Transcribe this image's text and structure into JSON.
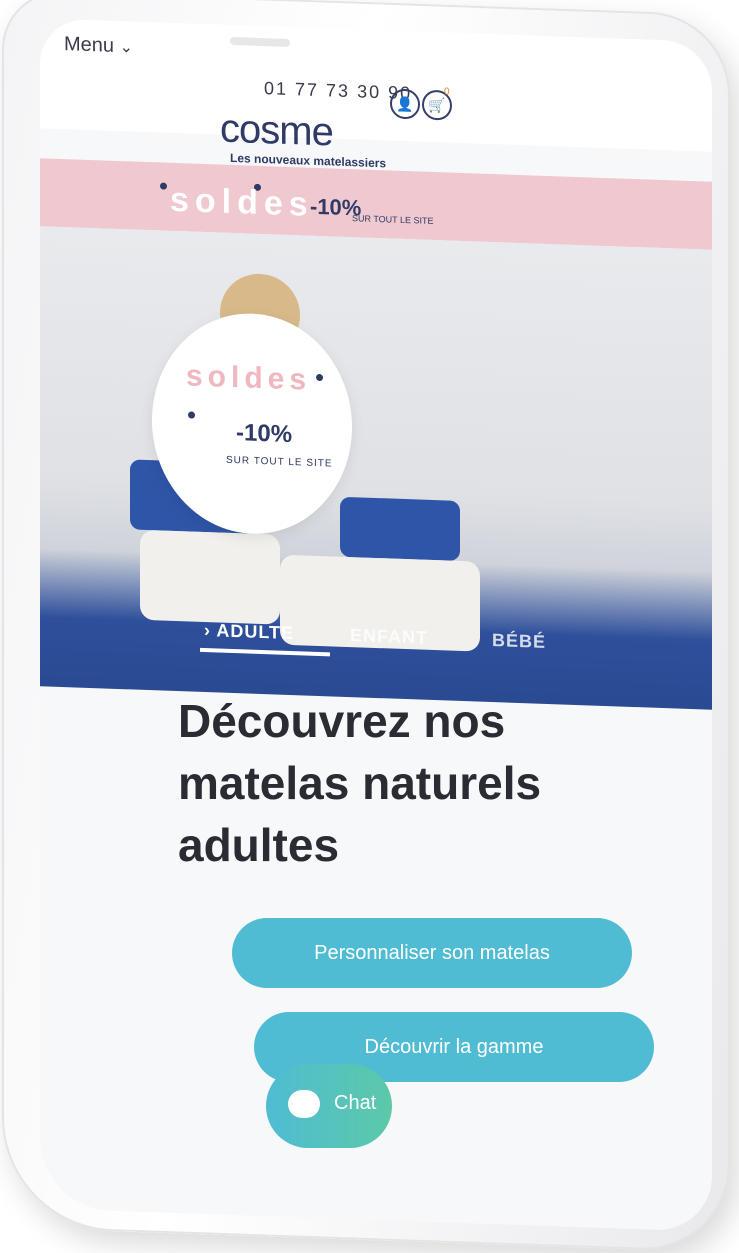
{
  "header": {
    "menu_label": "Menu",
    "phone": "01 77 73 30 90",
    "cart_count": "0",
    "logo": "cosme",
    "tagline": "Les nouveaux matelassiers"
  },
  "banner": {
    "soldes": "soldes",
    "discount": "-10%",
    "subtitle": "SUR TOUT LE SITE"
  },
  "hero": {
    "soldes": "soldes",
    "discount": "-10%",
    "subtitle": "SUR TOUT LE SITE",
    "tabs": [
      {
        "label": "ADULTE",
        "active": true
      },
      {
        "label": "ENFANT",
        "active": false
      },
      {
        "label": "BÉBÉ",
        "active": false
      }
    ]
  },
  "main": {
    "headline": "Découvrez nos matelas naturels adultes",
    "buttons": [
      {
        "label": "Personnaliser son matelas"
      },
      {
        "label": "Découvrir la gamme"
      }
    ]
  },
  "chat": {
    "label": "Chat"
  },
  "colors": {
    "accent": "#4fbcd3",
    "brand": "#2f3a66",
    "banner": "#efc9cf",
    "bedding": "#2f55a8"
  }
}
